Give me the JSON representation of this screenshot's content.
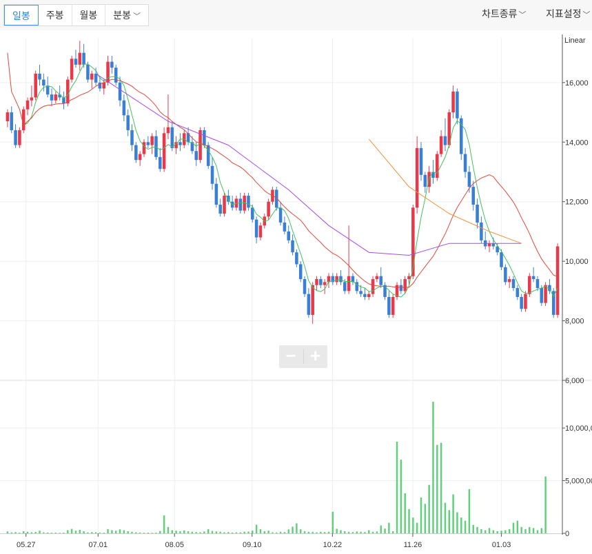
{
  "tabs": [
    {
      "label": "일봉",
      "active": true
    },
    {
      "label": "주봉",
      "active": false
    },
    {
      "label": "월봉",
      "active": false
    },
    {
      "label": "분봉",
      "active": false,
      "dropdown": true
    }
  ],
  "right_menu": {
    "chart_type": "차트종류",
    "settings": "지표설정"
  },
  "zoom": {
    "minus": "−",
    "plus": "+"
  },
  "colors": {
    "up": "#e8394a",
    "down": "#3a7fd6",
    "ma5": "#44c05a",
    "ma20": "#e0483a",
    "ma60": "#a64be8",
    "ma120": "#f0923a",
    "volume": "#5fd07a",
    "grid": "#eeeeee"
  },
  "chart_data": {
    "type": "candlestick",
    "scale_label": "Linear",
    "price_axis": {
      "ticks": [
        "16,000",
        "14,000",
        "12,000",
        "10,000",
        "8,000",
        "6,000"
      ],
      "range": [
        6000,
        17500
      ]
    },
    "volume_axis": {
      "ticks": [
        "10,000,0",
        "5,000,00",
        "0"
      ],
      "range": [
        0,
        14000000
      ]
    },
    "x_ticks": [
      "05.27",
      "07.01",
      "08.05",
      "09.10",
      "10.22",
      "11.26",
      "01.03"
    ],
    "candles": [
      [
        14700,
        15100,
        14500,
        15000
      ],
      [
        15000,
        15200,
        14300,
        14400
      ],
      [
        14400,
        14600,
        13800,
        13900
      ],
      [
        13900,
        14500,
        13800,
        14400
      ],
      [
        14400,
        15200,
        14300,
        15100
      ],
      [
        15100,
        15500,
        14900,
        15400
      ],
      [
        15400,
        15900,
        15200,
        15500
      ],
      [
        15500,
        16400,
        15400,
        16300
      ],
      [
        16300,
        16600,
        15900,
        16100
      ],
      [
        16100,
        16300,
        15700,
        15900
      ],
      [
        15900,
        16200,
        15500,
        15600
      ],
      [
        15600,
        15800,
        15200,
        15400
      ],
      [
        15400,
        15700,
        15300,
        15600
      ],
      [
        15600,
        15900,
        15400,
        15500
      ],
      [
        15500,
        15700,
        15100,
        15300
      ],
      [
        15300,
        16200,
        15200,
        16100
      ],
      [
        16100,
        16900,
        16000,
        16800
      ],
      [
        16800,
        17100,
        16500,
        16600
      ],
      [
        16600,
        17400,
        16400,
        17000
      ],
      [
        17000,
        17300,
        16500,
        16600
      ],
      [
        16600,
        16700,
        16000,
        16100
      ],
      [
        16100,
        16400,
        15800,
        16300
      ],
      [
        16300,
        16500,
        15900,
        16000
      ],
      [
        16000,
        16200,
        15700,
        15800
      ],
      [
        15800,
        16100,
        15600,
        16000
      ],
      [
        16000,
        16900,
        15900,
        16700
      ],
      [
        16700,
        16900,
        16300,
        16500
      ],
      [
        16500,
        16600,
        15900,
        16000
      ],
      [
        16000,
        16200,
        15200,
        15400
      ],
      [
        15400,
        15600,
        14700,
        14900
      ],
      [
        14900,
        15100,
        14200,
        14400
      ],
      [
        14400,
        14600,
        13700,
        13900
      ],
      [
        13900,
        14000,
        13300,
        13400
      ],
      [
        13400,
        13700,
        13200,
        13600
      ],
      [
        13600,
        14100,
        13500,
        14000
      ],
      [
        14000,
        14200,
        13800,
        13900
      ],
      [
        13900,
        14300,
        13600,
        14200
      ],
      [
        14200,
        14400,
        13400,
        13500
      ],
      [
        13500,
        13800,
        13000,
        13100
      ],
      [
        13100,
        14500,
        13000,
        14300
      ],
      [
        14300,
        15600,
        14100,
        14500
      ],
      [
        14500,
        14700,
        13700,
        13800
      ],
      [
        13800,
        14200,
        13600,
        14000
      ],
      [
        14000,
        14300,
        13700,
        13900
      ],
      [
        13900,
        14400,
        13800,
        14300
      ],
      [
        14300,
        14500,
        13900,
        14000
      ],
      [
        14000,
        14200,
        13600,
        13700
      ],
      [
        13700,
        14000,
        13200,
        13400
      ],
      [
        13400,
        14500,
        13300,
        14400
      ],
      [
        14400,
        14500,
        13800,
        13900
      ],
      [
        13900,
        14000,
        13100,
        13200
      ],
      [
        13200,
        13500,
        12400,
        12600
      ],
      [
        12600,
        12800,
        11800,
        11900
      ],
      [
        11900,
        12100,
        11500,
        11600
      ],
      [
        11600,
        12300,
        11500,
        12200
      ],
      [
        12200,
        12400,
        11900,
        12000
      ],
      [
        12000,
        12200,
        11700,
        11800
      ],
      [
        11800,
        12200,
        11700,
        12100
      ],
      [
        12100,
        12300,
        11600,
        11700
      ],
      [
        11700,
        12300,
        11600,
        12200
      ],
      [
        12200,
        12300,
        11700,
        11800
      ],
      [
        11800,
        11900,
        11300,
        11400
      ],
      [
        11400,
        11500,
        10600,
        10800
      ],
      [
        10800,
        11300,
        10700,
        11200
      ],
      [
        11200,
        11600,
        11100,
        11500
      ],
      [
        11500,
        12100,
        11400,
        12000
      ],
      [
        12000,
        12500,
        11900,
        12400
      ],
      [
        12400,
        12500,
        11700,
        11800
      ],
      [
        11800,
        12000,
        11200,
        11300
      ],
      [
        11300,
        11500,
        10900,
        11000
      ],
      [
        11000,
        11200,
        10600,
        10700
      ],
      [
        10700,
        10900,
        10200,
        10300
      ],
      [
        10300,
        10400,
        9800,
        9900
      ],
      [
        9900,
        10000,
        9300,
        9400
      ],
      [
        9400,
        9500,
        8800,
        8900
      ],
      [
        8900,
        9100,
        8100,
        8200
      ],
      [
        8200,
        9300,
        7900,
        9200
      ],
      [
        9200,
        9500,
        9000,
        9400
      ],
      [
        9400,
        9500,
        9100,
        9200
      ],
      [
        9200,
        9400,
        8900,
        9300
      ],
      [
        9300,
        9600,
        9100,
        9500
      ],
      [
        9500,
        9600,
        9200,
        9300
      ],
      [
        9300,
        9600,
        9200,
        9500
      ],
      [
        9500,
        9700,
        9200,
        9300
      ],
      [
        9300,
        9400,
        8900,
        9000
      ],
      [
        9000,
        11200,
        8900,
        9500
      ],
      [
        9500,
        9600,
        9200,
        9300
      ],
      [
        9300,
        9400,
        8900,
        9000
      ],
      [
        9000,
        9200,
        8800,
        8900
      ],
      [
        8900,
        9100,
        8700,
        8800
      ],
      [
        8800,
        9000,
        8700,
        8900
      ],
      [
        8900,
        9500,
        8800,
        9400
      ],
      [
        9400,
        9600,
        9300,
        9500
      ],
      [
        9500,
        9800,
        9100,
        9200
      ],
      [
        9200,
        9300,
        8700,
        8800
      ],
      [
        8800,
        9000,
        8100,
        8200
      ],
      [
        8200,
        8900,
        8100,
        8800
      ],
      [
        8800,
        9300,
        8700,
        9200
      ],
      [
        9200,
        9400,
        8900,
        9000
      ],
      [
        9000,
        9500,
        8900,
        9400
      ],
      [
        9400,
        9600,
        9200,
        9500
      ],
      [
        9500,
        11900,
        9400,
        11800
      ],
      [
        11800,
        14200,
        11600,
        13800
      ],
      [
        13800,
        14000,
        12700,
        12900
      ],
      [
        12900,
        13000,
        12300,
        12500
      ],
      [
        12500,
        13200,
        12300,
        13000
      ],
      [
        13000,
        13400,
        12600,
        12800
      ],
      [
        12800,
        13700,
        12700,
        13600
      ],
      [
        13600,
        14400,
        13500,
        14200
      ],
      [
        14200,
        14800,
        13700,
        13900
      ],
      [
        13900,
        15100,
        13800,
        15000
      ],
      [
        15000,
        15900,
        14800,
        15700
      ],
      [
        15700,
        15800,
        14600,
        14800
      ],
      [
        14800,
        14900,
        13400,
        13600
      ],
      [
        13600,
        13800,
        12800,
        13000
      ],
      [
        13000,
        13200,
        12300,
        12500
      ],
      [
        12500,
        12700,
        11700,
        11900
      ],
      [
        11900,
        12100,
        11100,
        11300
      ],
      [
        11300,
        11500,
        10600,
        10700
      ],
      [
        10700,
        11000,
        10400,
        10500
      ],
      [
        10500,
        10700,
        10300,
        10600
      ],
      [
        10600,
        10800,
        10400,
        10500
      ],
      [
        10500,
        10600,
        10200,
        10300
      ],
      [
        10300,
        10400,
        9700,
        9800
      ],
      [
        9800,
        9900,
        9200,
        9300
      ],
      [
        9300,
        9500,
        9100,
        9400
      ],
      [
        9400,
        9500,
        9000,
        9100
      ],
      [
        9100,
        9200,
        8700,
        8800
      ],
      [
        8800,
        8900,
        8300,
        8400
      ],
      [
        8400,
        9000,
        8300,
        8900
      ],
      [
        8900,
        9600,
        8800,
        9500
      ],
      [
        9500,
        9800,
        9300,
        9400
      ],
      [
        9400,
        9500,
        9000,
        9100
      ],
      [
        9100,
        9200,
        8500,
        8600
      ],
      [
        8600,
        9300,
        8500,
        9200
      ],
      [
        9200,
        9400,
        8900,
        9000
      ],
      [
        9000,
        9100,
        8100,
        8200
      ],
      [
        8200,
        10600,
        8100,
        10500
      ]
    ],
    "volume": [
      180000,
      90000,
      120000,
      60000,
      200000,
      150000,
      100000,
      130000,
      250000,
      90000,
      80000,
      60000,
      70000,
      50000,
      60000,
      300000,
      420000,
      250000,
      330000,
      200000,
      90000,
      120000,
      110000,
      80000,
      60000,
      400000,
      300000,
      250000,
      380000,
      300000,
      200000,
      150000,
      100000,
      80000,
      60000,
      70000,
      50000,
      60000,
      220000,
      1700000,
      600000,
      300000,
      250000,
      200000,
      280000,
      200000,
      150000,
      120000,
      100000,
      180000,
      400000,
      230000,
      180000,
      150000,
      100000,
      120000,
      80000,
      100000,
      90000,
      150000,
      170000,
      260000,
      820000,
      390000,
      200000,
      250000,
      100000,
      80000,
      150000,
      120000,
      370000,
      630000,
      950000,
      380000,
      200000,
      150000,
      150000,
      100000,
      150000,
      120000,
      150000,
      2050000,
      430000,
      300000,
      200000,
      150000,
      120000,
      180000,
      150000,
      120000,
      300000,
      150000,
      180000,
      750000,
      450000,
      1000000,
      200000,
      8700000,
      7000000,
      3800000,
      2300000,
      1500000,
      1000000,
      3400000,
      2800000,
      4600000,
      12500000,
      8400000,
      8600000,
      2900000,
      2200000,
      3700000,
      2000000,
      1500000,
      1200000,
      4200000,
      800000,
      600000,
      400000,
      300000,
      500000,
      300000,
      200000,
      250000,
      300000,
      400000,
      1000000,
      1200000,
      600000,
      400000,
      600000,
      500000,
      300000,
      500000,
      5400000
    ],
    "ma120": [
      [
        90,
        14100
      ],
      [
        100,
        12500
      ],
      [
        110,
        11600
      ],
      [
        120,
        11000
      ],
      [
        128,
        10600
      ]
    ],
    "ma60": [
      [
        22,
        16300
      ],
      [
        40,
        14700
      ],
      [
        55,
        13900
      ],
      [
        70,
        12400
      ],
      [
        80,
        11200
      ],
      [
        90,
        10300
      ],
      [
        100,
        10200
      ],
      [
        105,
        10400
      ],
      [
        110,
        10600
      ],
      [
        115,
        10600
      ],
      [
        120,
        10600
      ],
      [
        128,
        10600
      ]
    ]
  }
}
